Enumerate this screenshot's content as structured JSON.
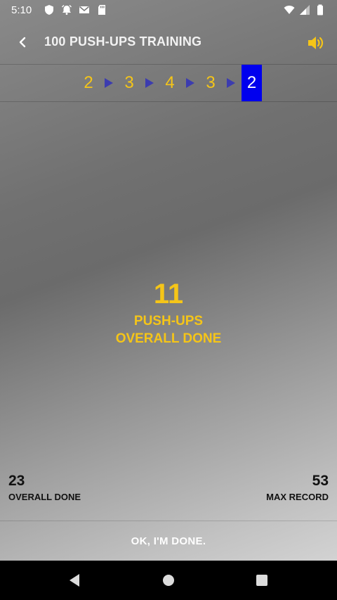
{
  "status_bar": {
    "time": "5:10",
    "left_icons": [
      "shield-icon",
      "alarm-icon",
      "mail-icon",
      "sd-card-icon"
    ],
    "right_icons": [
      "wifi-icon",
      "signal-icon",
      "battery-icon"
    ]
  },
  "toolbar": {
    "title": "100 PUSH-UPS TRAINING",
    "back_icon": "chevron-left-icon",
    "sound_icon": "volume-icon"
  },
  "sets": {
    "values": [
      "2",
      "3",
      "4",
      "3",
      "2"
    ],
    "current_index": 4,
    "arrow_color": "#3c3caf"
  },
  "counter": {
    "value": "11",
    "label_line1": "PUSH-UPS",
    "label_line2": "OVERALL DONE"
  },
  "stats": {
    "overall_done_value": "23",
    "overall_done_label": "OVERALL DONE",
    "max_record_value": "53",
    "max_record_label": "MAX RECORD"
  },
  "done_button": {
    "label": "OK, I'M DONE."
  },
  "colors": {
    "accent": "#f5c518",
    "current_set_bg": "#0000ee",
    "nav_bar": "#000000"
  },
  "nav_bar": {
    "icons": [
      "back-triangle-icon",
      "home-circle-icon",
      "recents-square-icon"
    ]
  }
}
